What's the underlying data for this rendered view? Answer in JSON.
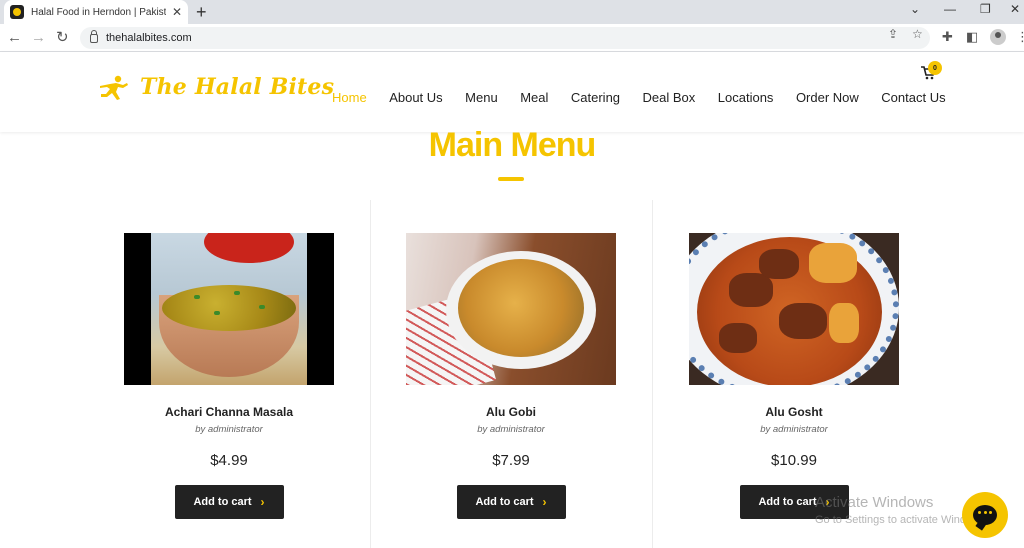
{
  "browser": {
    "tab_title": "Halal Food in Herndon | Pakistani",
    "url": "thehalalbites.com",
    "new_tab": "+",
    "tab_close": "✕"
  },
  "site": {
    "logo_text": "The Halal Bites",
    "brand_color": "#f5c400",
    "nav": [
      {
        "label": "Home",
        "active": true
      },
      {
        "label": "About Us"
      },
      {
        "label": "Menu"
      },
      {
        "label": "Meal"
      },
      {
        "label": "Catering"
      },
      {
        "label": "Deal Box"
      },
      {
        "label": "Locations"
      },
      {
        "label": "Order Now"
      },
      {
        "label": "Contact Us"
      }
    ],
    "cart_count": "0"
  },
  "main": {
    "title": "Main Menu",
    "products": [
      {
        "name": "Achari Channa Masala",
        "author": "by administrator",
        "price": "$4.99",
        "button": "Add to cart",
        "chevron": "›"
      },
      {
        "name": "Alu Gobi",
        "author": "by administrator",
        "price": "$7.99",
        "button": "Add to cart",
        "chevron": "›"
      },
      {
        "name": "Alu Gosht",
        "author": "by administrator",
        "price": "$10.99",
        "button": "Add to cart",
        "chevron": "›"
      }
    ]
  },
  "overlay": {
    "watermark_title": "Activate Windows",
    "watermark_sub": "Go to Settings to activate Windows."
  },
  "icons": {
    "back": "back-arrow-icon",
    "forward": "forward-arrow-icon",
    "reload": "reload-icon",
    "cart": "shopping-cart-icon",
    "chat": "chat-bubble-icon"
  }
}
